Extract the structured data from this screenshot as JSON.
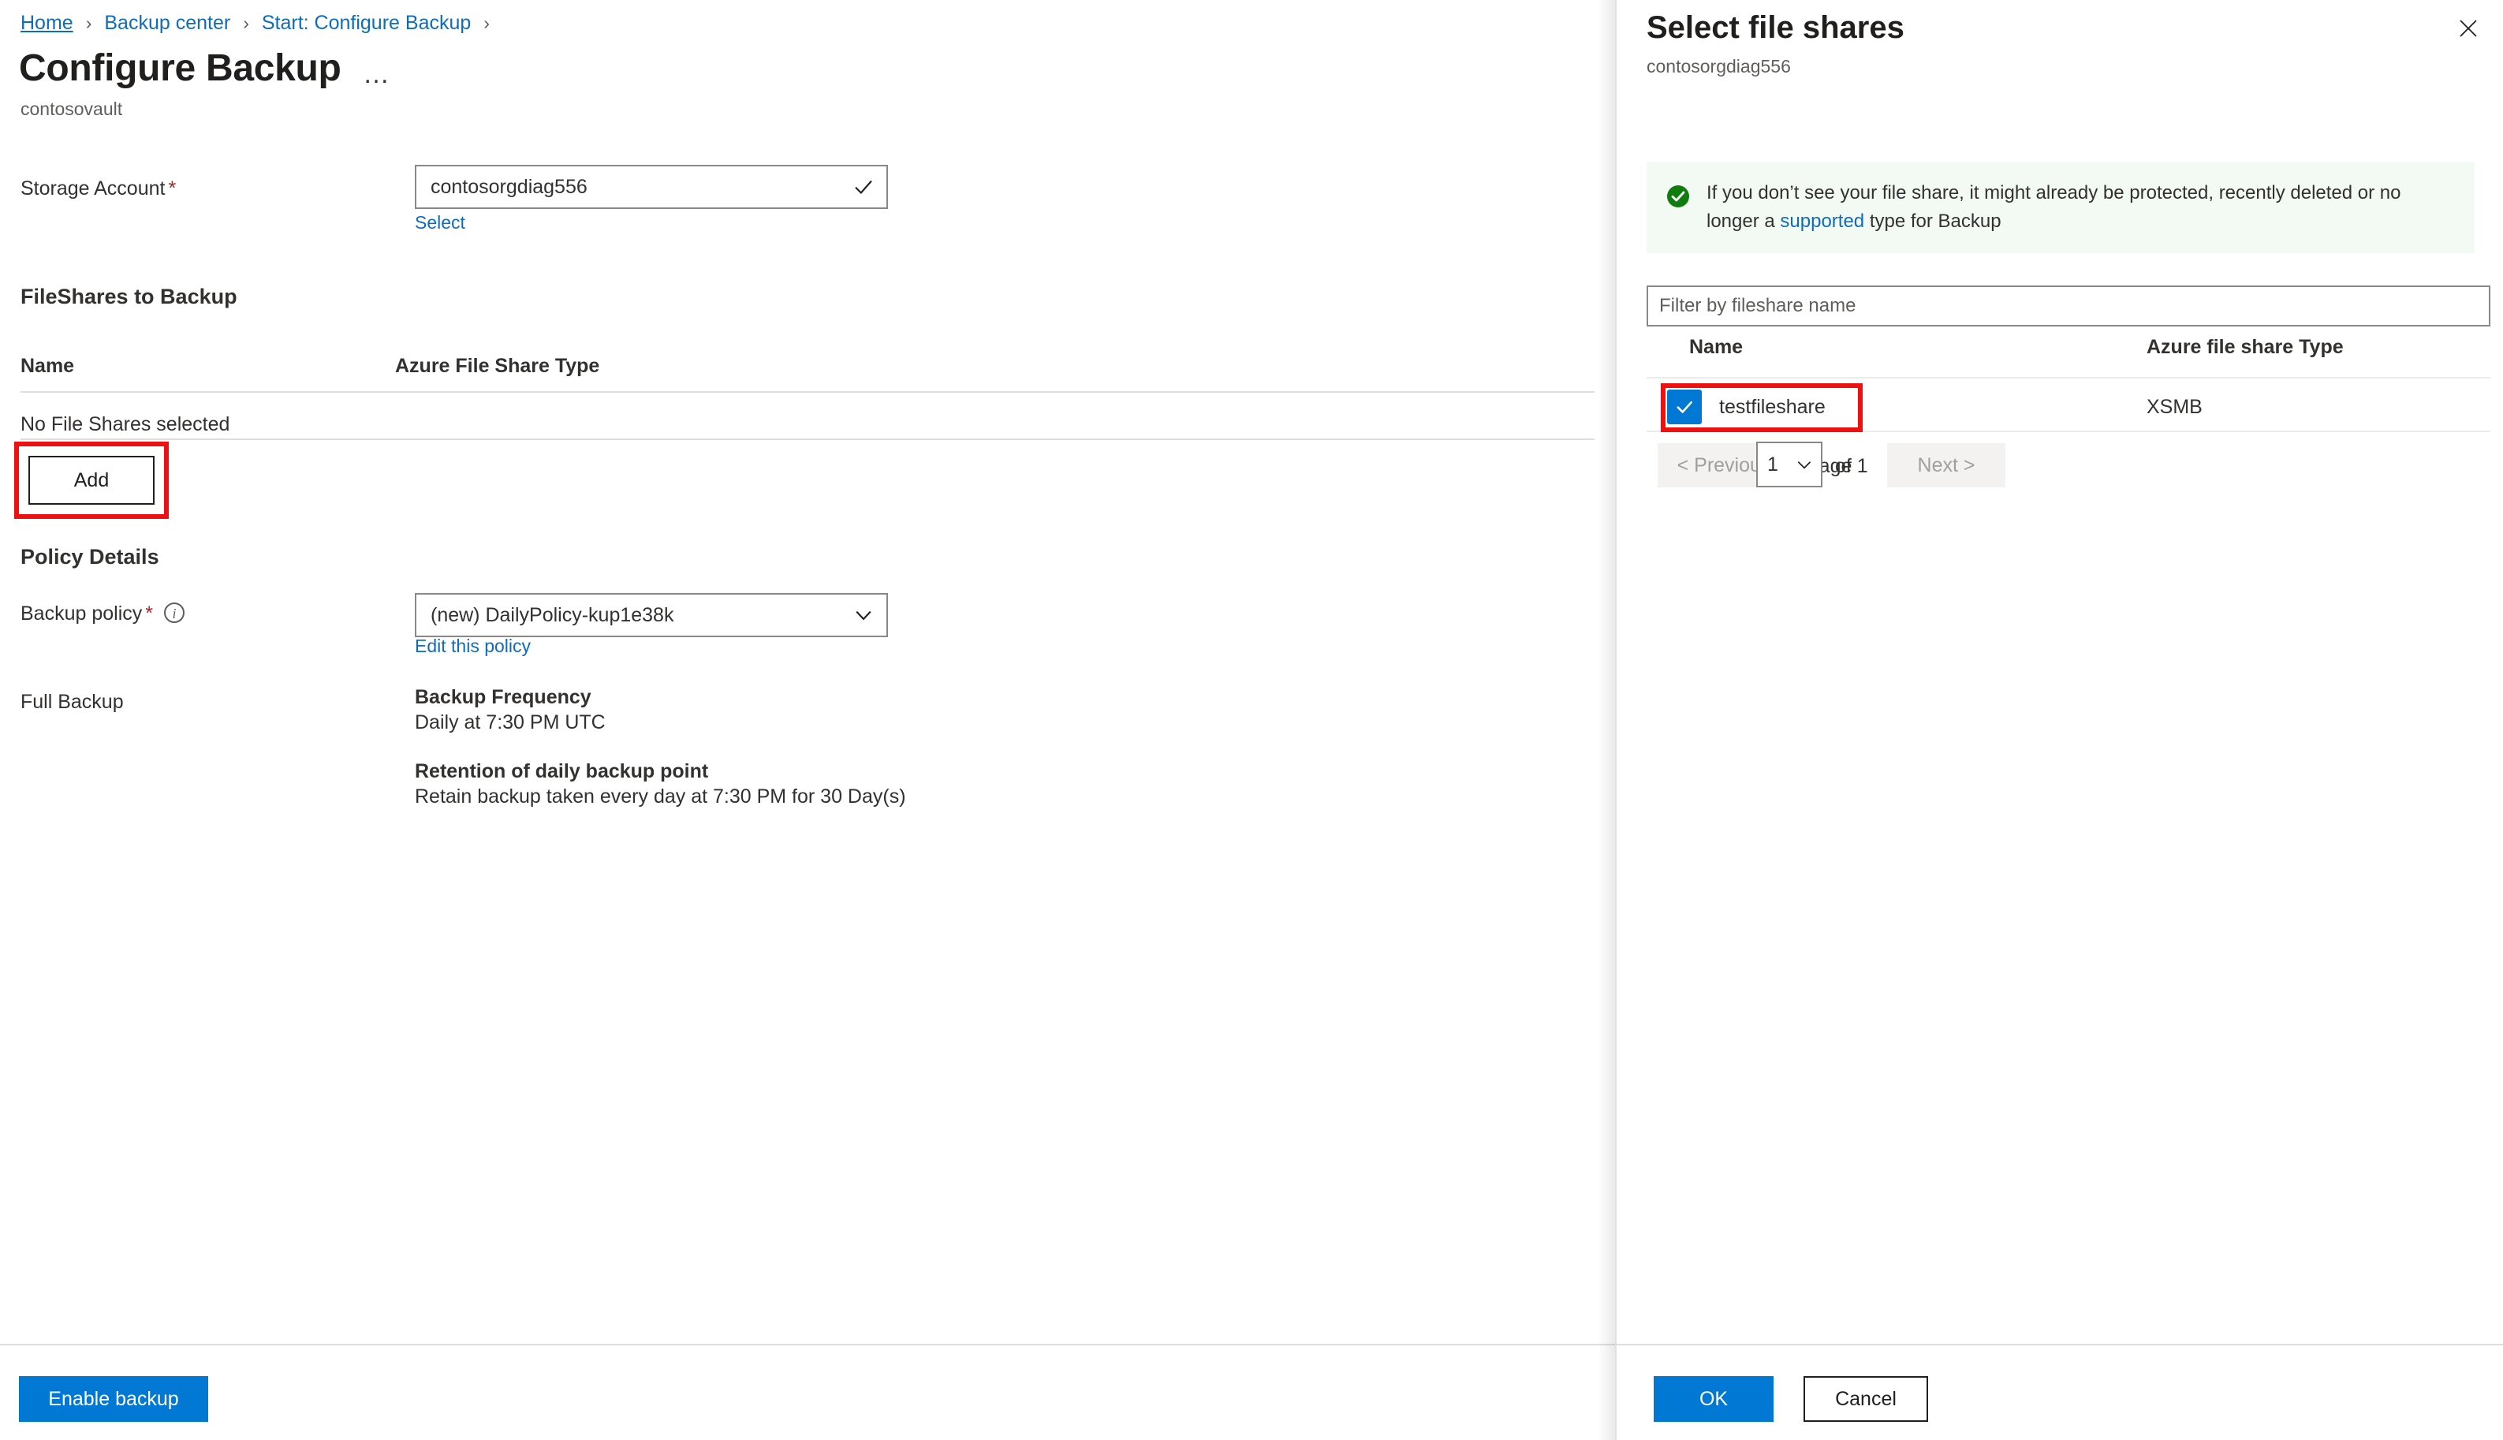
{
  "breadcrumb": {
    "items": [
      {
        "label": "Home",
        "current": false
      },
      {
        "label": "Backup center",
        "current": false
      },
      {
        "label": "Start: Configure Backup",
        "current": false
      }
    ],
    "separator": "›"
  },
  "blade": {
    "title": "Configure Backup",
    "subtitle": "contosovault",
    "more_label": "…"
  },
  "storage": {
    "label": "Storage Account",
    "required_marker": "*",
    "value": "contosorgdiag556",
    "status_icon": "checkmark-icon",
    "select_link": "Select"
  },
  "fileshares": {
    "section_title": "FileShares to Backup",
    "columns": [
      "Name",
      "Azure File Share Type"
    ],
    "rows": [],
    "empty_text": "No File Shares selected",
    "add_label": "Add"
  },
  "policy": {
    "section_title": "Policy Details",
    "backup_policy_label": "Backup policy",
    "required_marker": "*",
    "info_icon": "info-icon",
    "backup_policy_value": "(new) DailyPolicy-kup1e38k",
    "edit_link": "Edit this policy",
    "full_backup_label": "Full Backup",
    "frequency_heading": "Backup Frequency",
    "frequency_value": "Daily at 7:30 PM UTC",
    "retention_heading": "Retention of daily backup point",
    "retention_value": "Retain backup taken every day at 7:30 PM for 30 Day(s)"
  },
  "blade_footer": {
    "primary_label": "Enable backup"
  },
  "pane": {
    "title": "Select file shares",
    "subtitle": "contosorgdiag556",
    "close_icon": "close-icon",
    "info": {
      "icon": "success-check-icon",
      "text_before": "If you don’t see your file share, it might already be protected, recently deleted or no longer a",
      "link": "supported",
      "text_after": "type for Backup"
    },
    "filter": {
      "placeholder": "Filter by fileshare name",
      "value": ""
    },
    "columns": [
      "Name",
      "Azure file share Type"
    ],
    "rows": [
      {
        "name": "testfileshare",
        "type": "XSMB",
        "checked": true
      }
    ],
    "pagination": {
      "previous_label": "< Previous",
      "page_label": "Page",
      "page_value": "1",
      "of_label": "of 1",
      "next_label": "Next >"
    },
    "footer": {
      "ok_label": "OK",
      "cancel_label": "Cancel"
    }
  },
  "colors": {
    "accent": "#0078d4",
    "link": "#0f6cbd",
    "required": "#a4262c",
    "annotation": "#ee1111",
    "success": "#107c10",
    "info_bg": "#f3faf3"
  }
}
